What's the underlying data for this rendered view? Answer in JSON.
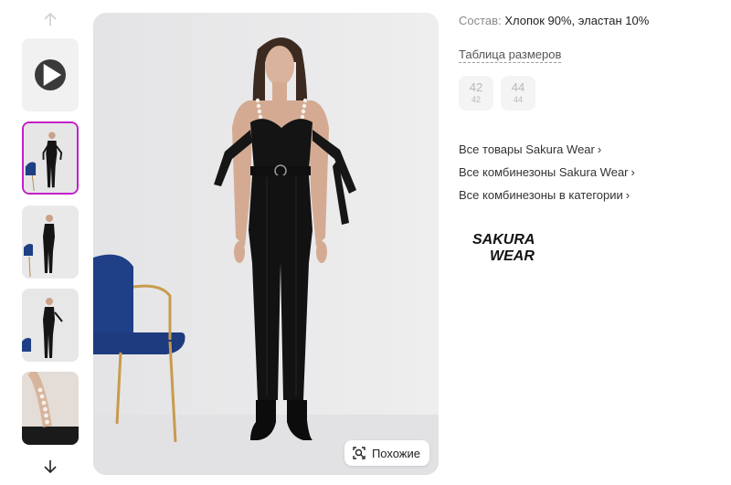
{
  "gallery": {
    "similar_label": "Похожие",
    "active_thumb_color": "#c21fc9"
  },
  "product": {
    "composition_label": "Состав:",
    "composition_value": "Хлопок 90%, эластан 10%",
    "size_table_label": "Таблица размеров",
    "sizes": [
      {
        "label": "42",
        "sub": "42",
        "available": false
      },
      {
        "label": "44",
        "sub": "44",
        "available": false
      }
    ],
    "links": [
      {
        "label": "Все товары Sakura Wear"
      },
      {
        "label": "Все комбинезоны Sakura Wear"
      },
      {
        "label": "Все комбинезоны в категории"
      }
    ],
    "brand_logo_text": [
      "SAKURA",
      "WEAR"
    ]
  }
}
